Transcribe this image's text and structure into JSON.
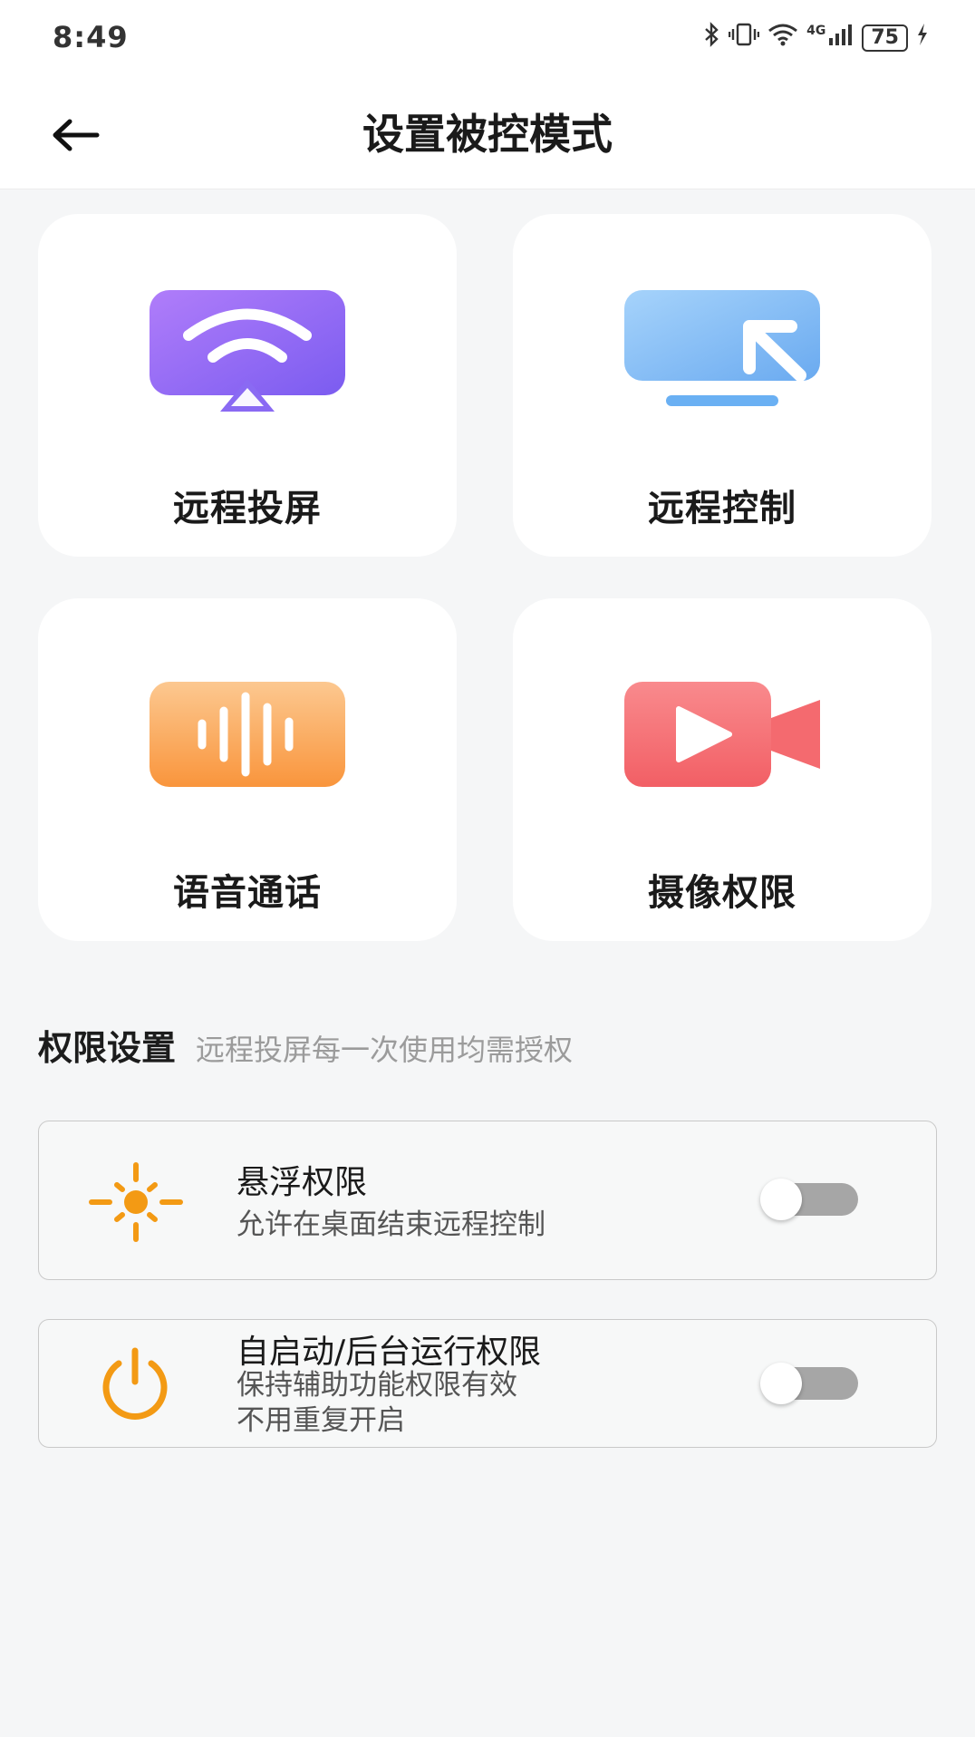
{
  "status_bar": {
    "time": "8:49",
    "network": "4G",
    "battery": "75",
    "icons": [
      "bluetooth-icon",
      "vibrate-icon",
      "wifi-icon",
      "signal-icon",
      "battery-icon",
      "charging-icon"
    ]
  },
  "header": {
    "title": "设置被控模式",
    "back_icon": "arrow-left-icon"
  },
  "modes": [
    {
      "label": "远程投屏",
      "icon": "screen-cast-icon",
      "color": "#8e6ef5"
    },
    {
      "label": "远程控制",
      "icon": "remote-control-icon",
      "color": "#6fb0f2"
    },
    {
      "label": "语音通话",
      "icon": "voice-wave-icon",
      "color": "#f9a04d"
    },
    {
      "label": "摄像权限",
      "icon": "video-camera-icon",
      "color": "#f46a6f"
    }
  ],
  "permissions_section": {
    "title": "权限设置",
    "note": "远程投屏每一次使用均需授权"
  },
  "permissions": [
    {
      "title": "悬浮权限",
      "description": "允许在桌面结束远程控制",
      "icon": "sun-icon",
      "enabled": false
    },
    {
      "title": "自启动/后台运行权限",
      "description_line1": "保持辅助功能权限有效",
      "description_line2": "不用重复开启",
      "icon": "power-icon",
      "enabled": false
    }
  ],
  "colors": {
    "accent_orange": "#f39a14",
    "toggle_off": "#a6a6a6"
  }
}
